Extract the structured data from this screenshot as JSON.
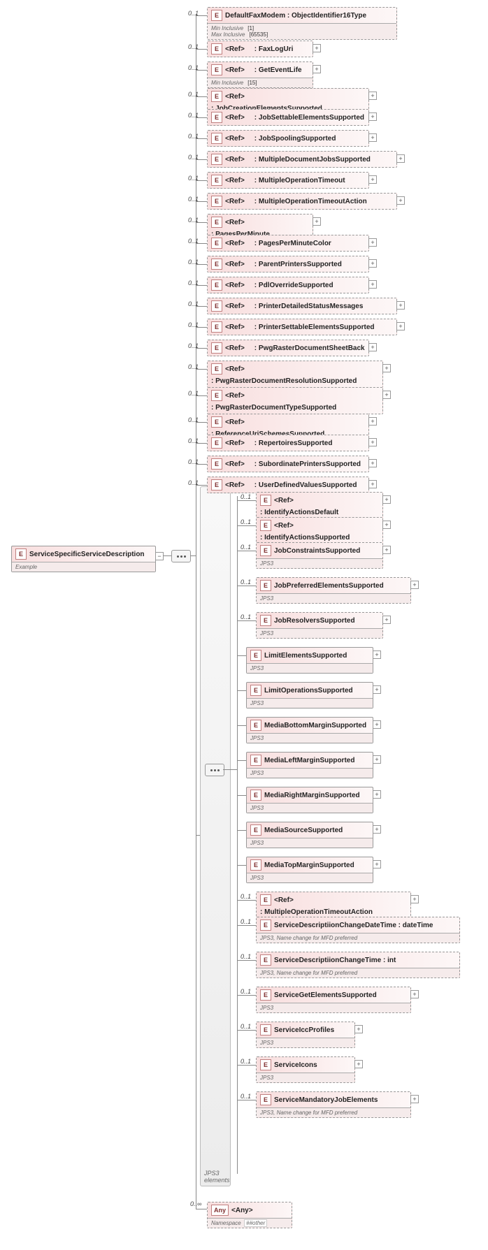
{
  "root": {
    "label": "ServiceSpecificServiceDescription",
    "footer": "Example"
  },
  "occurrence_01": "0..1",
  "occurrence_0inf": "0..∞",
  "tall_group": {
    "label": "JPS3 elements"
  },
  "col1": [
    {
      "ref": false,
      "label": "DefaultFaxModem : ObjectIdentifier16Type",
      "footer_rows": [
        {
          "k": "Min Inclusive",
          "v": "[1]"
        },
        {
          "k": "Max Inclusive",
          "v": "[65535]"
        }
      ],
      "dashed": true,
      "expand": false
    },
    {
      "ref": true,
      "label": ": FaxLogUri",
      "dashed": true,
      "expand": true
    },
    {
      "ref": true,
      "label": ": GetEventLife",
      "dashed": true,
      "footer_rows": [
        {
          "k": "Min Inclusive",
          "v": "[15]"
        }
      ],
      "expand": true
    },
    {
      "ref": true,
      "label": ": JobCreationElementsSupported",
      "dashed": true,
      "expand": true
    },
    {
      "ref": true,
      "label": ": JobSettableElementsSupported",
      "dashed": true,
      "expand": true
    },
    {
      "ref": true,
      "label": ": JobSpoolingSupported",
      "dashed": true,
      "expand": true
    },
    {
      "ref": true,
      "label": ": MultipleDocumentJobsSupported",
      "dashed": true,
      "expand": true
    },
    {
      "ref": true,
      "label": ": MultipleOperationTimeout",
      "dashed": true,
      "expand": true
    },
    {
      "ref": true,
      "label": ": MultipleOperationTimeoutAction",
      "dashed": true,
      "expand": true
    },
    {
      "ref": true,
      "label": ": PagesPerMinute",
      "dashed": true,
      "expand": true
    },
    {
      "ref": true,
      "label": ": PagesPerMinuteColor",
      "dashed": true,
      "expand": true
    },
    {
      "ref": true,
      "label": ": ParentPrintersSupported",
      "dashed": true,
      "expand": true
    },
    {
      "ref": true,
      "label": ": PdlOverrideSupported",
      "dashed": true,
      "expand": true
    },
    {
      "ref": true,
      "label": ": PrinterDetailedStatusMessages",
      "dashed": true,
      "expand": true
    },
    {
      "ref": true,
      "label": ": PrinterSettableElementsSupported",
      "dashed": true,
      "expand": true
    },
    {
      "ref": true,
      "label": ": PwgRasterDocumentSheetBack",
      "dashed": true,
      "expand": true
    },
    {
      "ref": true,
      "label": ": PwgRasterDocumentResolutionSupported",
      "dashed": true,
      "expand": true,
      "tall": true
    },
    {
      "ref": true,
      "label": ": PwgRasterDocumentTypeSupported",
      "dashed": true,
      "expand": true,
      "tall": true
    },
    {
      "ref": true,
      "label": ": ReferenceUriSchemesSupported",
      "dashed": true,
      "expand": true
    },
    {
      "ref": true,
      "label": ": RepertoiresSupported",
      "dashed": true,
      "expand": true
    },
    {
      "ref": true,
      "label": ": SubordinatePrintersSupported",
      "dashed": true,
      "expand": true
    },
    {
      "ref": true,
      "label": ": UserDefinedValuesSupported",
      "dashed": true,
      "expand": true
    }
  ],
  "col2": [
    {
      "ref": true,
      "label": ": IdentifyActionsDefault",
      "dashed": true,
      "footer": null,
      "expand": true,
      "occ": "0..1"
    },
    {
      "ref": true,
      "label": ": IdentifyActionsSupported",
      "dashed": true,
      "footer": null,
      "expand": true,
      "occ": "0..1"
    },
    {
      "ref": false,
      "label": "JobConstraintsSupported",
      "dashed": true,
      "footer": "JPS3",
      "expand": true,
      "occ": "0..1"
    },
    {
      "ref": false,
      "label": "JobPreferredElementsSupported",
      "dashed": true,
      "footer": "JPS3",
      "expand": true,
      "occ": "0..1"
    },
    {
      "ref": false,
      "label": "JobResolversSupported",
      "dashed": true,
      "footer": "JPS3",
      "expand": true,
      "occ": "0..1"
    },
    {
      "ref": false,
      "label": "LimitElementsSupported",
      "dashed": false,
      "footer": "JPS3",
      "expand": true,
      "occ": null
    },
    {
      "ref": false,
      "label": "LimitOperationsSupported",
      "dashed": false,
      "footer": "JPS3",
      "expand": true,
      "occ": null
    },
    {
      "ref": false,
      "label": "MediaBottomMarginSupported",
      "dashed": false,
      "footer": "JPS3",
      "expand": true,
      "occ": null
    },
    {
      "ref": false,
      "label": "MediaLeftMarginSupported",
      "dashed": false,
      "footer": "JPS3",
      "expand": true,
      "occ": null
    },
    {
      "ref": false,
      "label": "MediaRightMarginSupported",
      "dashed": false,
      "footer": "JPS3",
      "expand": true,
      "occ": null
    },
    {
      "ref": false,
      "label": "MediaSourceSupported",
      "dashed": false,
      "footer": "JPS3",
      "expand": true,
      "occ": null
    },
    {
      "ref": false,
      "label": "MediaTopMarginSupported",
      "dashed": false,
      "footer": "JPS3",
      "expand": true,
      "occ": null
    },
    {
      "ref": true,
      "label": ": MultipleOperationTimeoutAction",
      "dashed": true,
      "footer": null,
      "expand": true,
      "occ": "0..1"
    },
    {
      "ref": false,
      "label": "ServiceDescriptiionChangeDateTime : dateTime",
      "dashed": true,
      "footer": "JPS3, Name change  for MFD preferred",
      "expand": false,
      "occ": "0..1",
      "wide": true
    },
    {
      "ref": false,
      "label": "ServiceDescriptiionChangeTime : int",
      "dashed": true,
      "footer": "JPS3, Name change  for MFD preferred",
      "expand": false,
      "occ": "0..1",
      "wide": true
    },
    {
      "ref": false,
      "label": "ServiceGetElementsSupported",
      "dashed": true,
      "footer": "JPS3",
      "expand": true,
      "occ": "0..1"
    },
    {
      "ref": false,
      "label": "ServiceIccProfiles",
      "dashed": true,
      "footer": "JPS3",
      "expand": true,
      "occ": "0..1"
    },
    {
      "ref": false,
      "label": "ServiceIcons",
      "dashed": true,
      "footer": "JPS3",
      "expand": true,
      "occ": "0..1"
    },
    {
      "ref": false,
      "label": "ServiceMandatoryJobElements",
      "dashed": true,
      "footer": "JPS3, Name change  for MFD preferred",
      "expand": true,
      "occ": "0..1"
    }
  ],
  "any": {
    "label": "<Any>",
    "ns_label": "Namespace",
    "ns_val": "##other",
    "occ": "0..∞"
  },
  "ref_text": "<Ref>"
}
